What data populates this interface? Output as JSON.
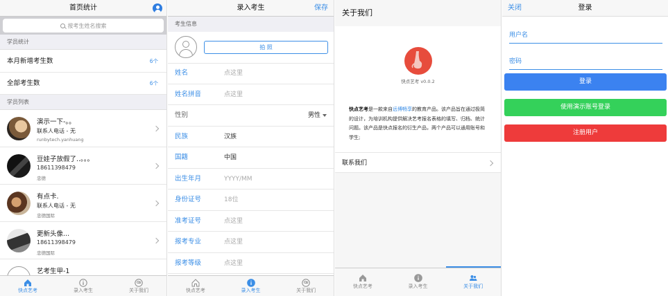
{
  "home": {
    "title": "首页统计",
    "search_placeholder": "按考生姓名搜索",
    "stats_header": "学员统计",
    "stats": [
      {
        "label": "本月新增考生数",
        "count": "6个"
      },
      {
        "label": "全部考生数",
        "count": "6个"
      }
    ],
    "list_header": "学员列表",
    "students": [
      {
        "name": "演示一下-。。",
        "phone": "联系人电话 - 无",
        "org": "runbytech.yanhuang"
      },
      {
        "name": "豆娃子放假了..。。。",
        "phone": "18611398479",
        "org": "忠德"
      },
      {
        "name": "有点卡.",
        "phone": "联系人电话 - 无",
        "org": "忠德国际"
      },
      {
        "name": "更新头像...",
        "phone": "18611398479",
        "org": "忠德国际"
      },
      {
        "name": "艺考生甲-1",
        "phone": "",
        "org": ""
      }
    ]
  },
  "tabs": [
    "快点艺考",
    "录入考生",
    "关于我们"
  ],
  "entry": {
    "title": "录入考生",
    "save": "保存",
    "section": "考生信息",
    "photo_button": "拍 照",
    "fields": [
      {
        "label": "姓名",
        "value": "点这里",
        "placeholder": true
      },
      {
        "label": "姓名拼音",
        "value": "点这里",
        "placeholder": true
      },
      {
        "label": "性别",
        "value": "男性",
        "select": true
      },
      {
        "label": "民族",
        "value": "汉族",
        "placeholder": false
      },
      {
        "label": "国籍",
        "value": "中国",
        "placeholder": false
      },
      {
        "label": "出生年月",
        "value": "YYYY/MM",
        "placeholder": true
      },
      {
        "label": "身份证号",
        "value": "18位",
        "placeholder": true
      },
      {
        "label": "准考证号",
        "value": "点这里",
        "placeholder": true
      },
      {
        "label": "报考专业",
        "value": "点这里",
        "placeholder": true
      },
      {
        "label": "报考等级",
        "value": "点这里",
        "placeholder": true
      }
    ]
  },
  "about": {
    "title": "关于我们",
    "version": "快点艺考 v0.0.2",
    "brand": "快点艺考",
    "text_a": "是一款来自",
    "link": "远博畅享",
    "text_b": "的教育产品。该产品旨在通过极简的设计，为培训机构提供解决艺考报名表格的填写、归档、统计问题。该产品是快点报名的衍生产品，两个产品可以通用账号和学生;",
    "contact": "联系我们"
  },
  "login": {
    "close": "关闭",
    "title": "登录",
    "username": "用户名",
    "password": "密码",
    "login_button": "登录",
    "demo_button": "使用演示账号登录",
    "register_button": "注册用户",
    "colors": {
      "primary": "#3b82f0",
      "demo": "#34d15a",
      "register": "#ee3b3b"
    }
  }
}
